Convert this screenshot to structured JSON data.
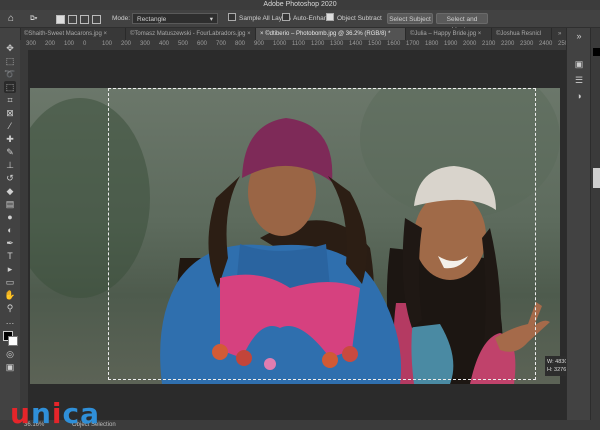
{
  "app": {
    "title": "Adobe Photoshop 2020"
  },
  "options": {
    "mode_label": "Mode:",
    "mode_value": "Rectangle",
    "sample_all_layers": "Sample All Layers",
    "auto_enhance": "Auto-Enhance",
    "object_subtract": "Object Subtract",
    "select_subject": "Select Subject",
    "select_and_mask": "Select and Mask..."
  },
  "tabs": [
    {
      "label": "©Shaith-Sweet Macarons.jpg"
    },
    {
      "label": "©Tomasz Matuszewski - FourLabradors.jpg"
    },
    {
      "label": "©dtiberio – Photobomb.jpg @ 36.2% (RGB/8) *"
    },
    {
      "label": "©Julia – Happy Bride.jpg"
    },
    {
      "label": "©Joshua Resnicl"
    }
  ],
  "ruler_ticks": [
    "300",
    "200",
    "100",
    "0",
    "100",
    "200",
    "300",
    "400",
    "500",
    "600",
    "700",
    "800",
    "900",
    "1000",
    "1100",
    "1200",
    "1300",
    "1400",
    "1500",
    "1600",
    "1700",
    "1800",
    "1900",
    "2000",
    "2100",
    "2200",
    "2300",
    "2400",
    "2500"
  ],
  "selection_info": {
    "width": "W: 4830 px",
    "height": "H: 3276 px"
  },
  "status": {
    "zoom": "36.16%",
    "tool": "Object Selection"
  },
  "watermark": {
    "brand": "unica"
  },
  "colors": {
    "accent_red": "#e5252a",
    "accent_blue": "#2f8fd8"
  }
}
